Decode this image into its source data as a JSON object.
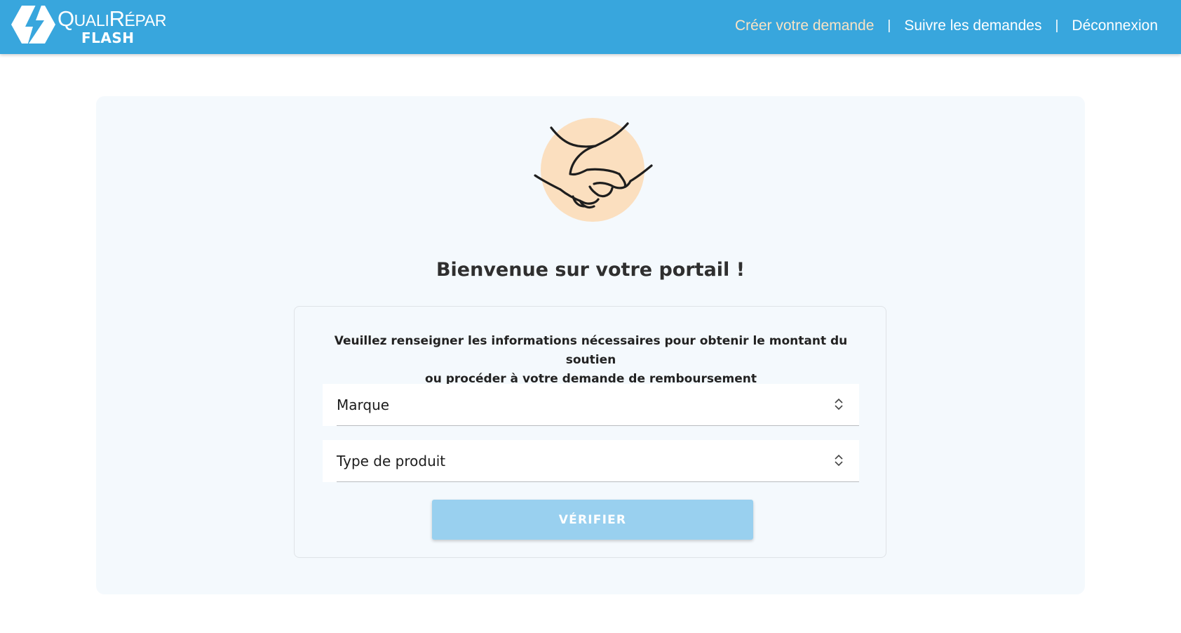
{
  "header": {
    "logo": {
      "text_big_1": "Q",
      "text_small_1": "UALI",
      "text_big_2": "R",
      "text_small_2": "ÉPAR",
      "subtitle": "FLASH"
    },
    "nav": [
      {
        "label": "Créer votre demande",
        "active": true
      },
      {
        "label": "Suivre les demandes",
        "active": false
      },
      {
        "label": "Déconnexion",
        "active": false
      }
    ],
    "nav_separator": "|"
  },
  "main": {
    "illustration_icon": "handshake-icon",
    "title": "Bienvenue sur votre portail !",
    "form": {
      "instructions_line1": "Veuillez renseigner les informations nécessaires pour obtenir le montant du soutien",
      "instructions_line2": "ou procéder à votre demande de remboursement",
      "brand_select_label": "Marque",
      "product_type_select_label": "Type de produit",
      "verify_button_label": "VÉRIFIER"
    }
  },
  "colors": {
    "header_bg": "#38a6dd",
    "nav_active": "#f9e3c4",
    "card_bg": "#f4f9fd",
    "illustration_circle": "#fbdfbf",
    "button_bg": "#99d0ef"
  }
}
